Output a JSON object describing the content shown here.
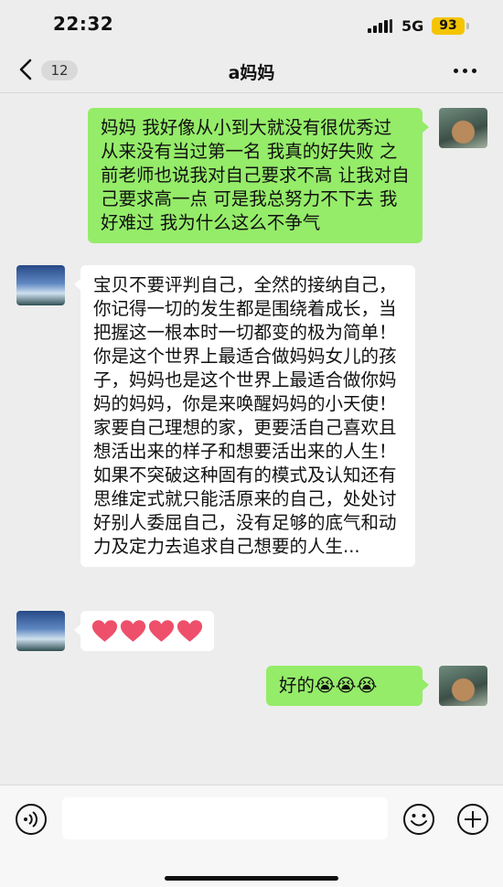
{
  "status_bar": {
    "time": "22:32",
    "network": "5G",
    "battery": "93"
  },
  "header": {
    "back_count": "12",
    "title": "a妈妈",
    "icons": [
      "chevron-left-icon",
      "more-icon"
    ]
  },
  "messages": [
    {
      "sender": "me",
      "text": "妈妈 我好像从小到大就没有很优秀过 从来没有当过第一名 我真的好失败 之前老师也说我对自己要求不高 让我对自己要求高一点 可是我总努力不下去 我好难过 我为什么这么不争气"
    },
    {
      "sender": "them",
      "text": "宝贝不要评判自己，全然的接纳自己，你记得一切的发生都是围绕着成长，当把握这一根本时一切都变的极为简单！你是这个世界上最适合做妈妈女儿的孩子，妈妈也是这个世界上最适合做你妈妈的妈妈，你是来唤醒妈妈的小天使！家要自己理想的家，更要活自己喜欢且想活出来的样子和想要活出来的人生！如果不突破这种固有的模式及认知还有思维定式就只能活原来的自己，处处讨好别人委屈自己，没有足够的底气和动力及定力去追求自己想要的人生..."
    },
    {
      "sender": "them",
      "emoji": [
        "heart-icon",
        "heart-icon",
        "heart-icon",
        "heart-icon"
      ]
    },
    {
      "sender": "me",
      "text": "好的😭😭😭"
    }
  ],
  "input_bar": {
    "icons": [
      "voice-icon",
      "emoji-icon",
      "plus-icon"
    ]
  },
  "colors": {
    "background": "#ededed",
    "my_bubble": "#95ec69",
    "their_bubble": "#ffffff",
    "battery": "#f5c400",
    "heart": "#ee4f6b"
  }
}
